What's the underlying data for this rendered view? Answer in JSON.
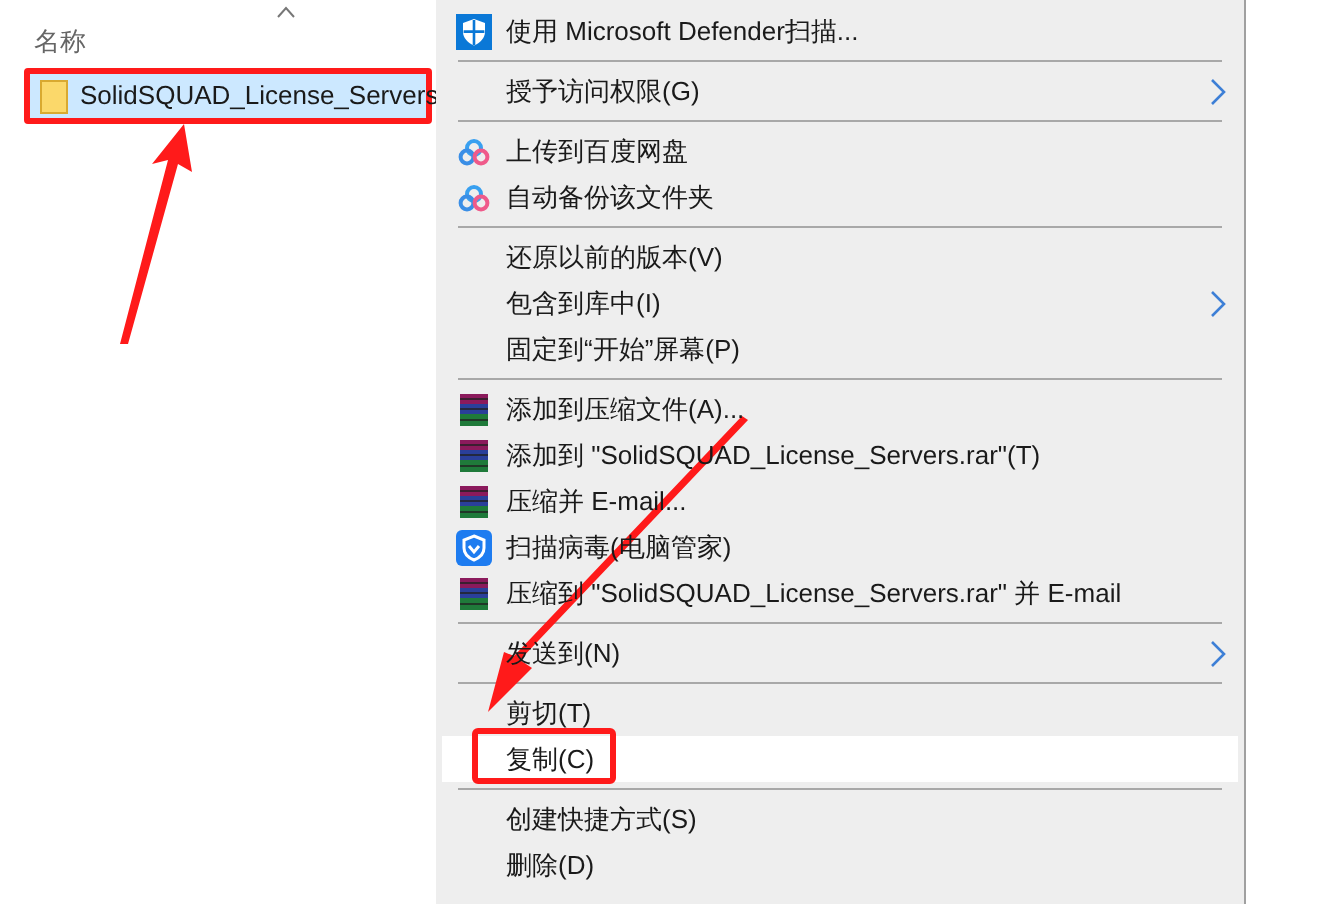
{
  "file_list": {
    "column_header": "名称",
    "files": [
      {
        "name": "SolidSQUAD_License_Servers",
        "selected": true,
        "annotated": true
      }
    ]
  },
  "context_menu": {
    "items": [
      {
        "kind": "defender",
        "label": "使用 Microsoft Defender扫描...",
        "submenu": false,
        "selected": false,
        "annotated": false
      },
      {
        "kind": "separator"
      },
      {
        "kind": "plain",
        "label": "授予访问权限(G)",
        "submenu": true,
        "selected": false,
        "annotated": false
      },
      {
        "kind": "separator"
      },
      {
        "kind": "baidu",
        "label": "上传到百度网盘",
        "submenu": false,
        "selected": false,
        "annotated": false
      },
      {
        "kind": "baidu",
        "label": "自动备份该文件夹",
        "submenu": false,
        "selected": false,
        "annotated": false
      },
      {
        "kind": "separator"
      },
      {
        "kind": "plain",
        "label": "还原以前的版本(V)",
        "submenu": false,
        "selected": false,
        "annotated": false
      },
      {
        "kind": "plain",
        "label": "包含到库中(I)",
        "submenu": true,
        "selected": false,
        "annotated": false
      },
      {
        "kind": "plain",
        "label": "固定到“开始”屏幕(P)",
        "submenu": false,
        "selected": false,
        "annotated": false
      },
      {
        "kind": "separator"
      },
      {
        "kind": "winrar",
        "label": "添加到压缩文件(A)...",
        "submenu": false,
        "selected": false,
        "annotated": false
      },
      {
        "kind": "winrar",
        "label": "添加到 \"SolidSQUAD_License_Servers.rar\"(T)",
        "submenu": false,
        "selected": false,
        "annotated": false
      },
      {
        "kind": "winrar",
        "label": "压缩并 E-mail...",
        "submenu": false,
        "selected": false,
        "annotated": false
      },
      {
        "kind": "guard",
        "label": "扫描病毒(电脑管家)",
        "submenu": false,
        "selected": false,
        "annotated": false
      },
      {
        "kind": "winrar",
        "label": "压缩到 \"SolidSQUAD_License_Servers.rar\" 并 E-mail",
        "submenu": false,
        "selected": false,
        "annotated": false
      },
      {
        "kind": "separator"
      },
      {
        "kind": "plain",
        "label": "发送到(N)",
        "submenu": true,
        "selected": false,
        "annotated": false
      },
      {
        "kind": "separator"
      },
      {
        "kind": "plain",
        "label": "剪切(T)",
        "submenu": false,
        "selected": false,
        "annotated": false
      },
      {
        "kind": "plain",
        "label": "复制(C)",
        "submenu": false,
        "selected": true,
        "annotated": true
      },
      {
        "kind": "separator"
      },
      {
        "kind": "plain",
        "label": "创建快捷方式(S)",
        "submenu": false,
        "selected": false,
        "annotated": false
      },
      {
        "kind": "plain",
        "label": "删除(D)",
        "submenu": false,
        "selected": false,
        "annotated": false
      }
    ]
  }
}
